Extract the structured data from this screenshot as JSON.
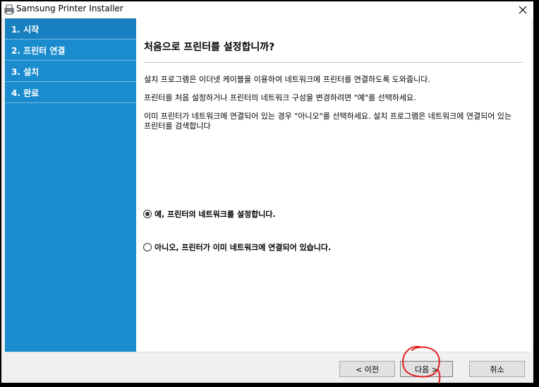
{
  "window": {
    "title": "Samsung Printer Installer"
  },
  "sidebar": {
    "steps": [
      {
        "label": "1. 시작"
      },
      {
        "label": "2. 프린터 연결"
      },
      {
        "label": "3. 설치"
      },
      {
        "label": "4. 완료"
      }
    ]
  },
  "main": {
    "heading": "처음으로 프린터를 설정합니까?",
    "paragraphs": [
      "설치 프로그램은 이더넷 케이블을 이용하여 네트워크에 프린터를 연결하도록 도와줍니다.",
      "프린터를 처음 설정하거나 프린터의 네트워크 구성을 변경하려면 \"예\"를 선택하세요.",
      "이미 프린터가 네트워크에 연결되어 있는 경우 \"아니오\"를 선택하세요. 설치 프로그램은 네트워크에 연결되어 있는 프린터를 검색합니다"
    ],
    "options": [
      {
        "label": "예, 프린터의 네트워크를 설정합니다.",
        "selected": true
      },
      {
        "label": "아니오, 프린터가 이미 네트워크에 연결되어 있습니다.",
        "selected": false
      }
    ]
  },
  "buttons": {
    "back": "< 이전",
    "next": "다음 >",
    "cancel": "취소"
  },
  "colors": {
    "sidebar": "#1a8cce",
    "annotation": "#e02020"
  }
}
